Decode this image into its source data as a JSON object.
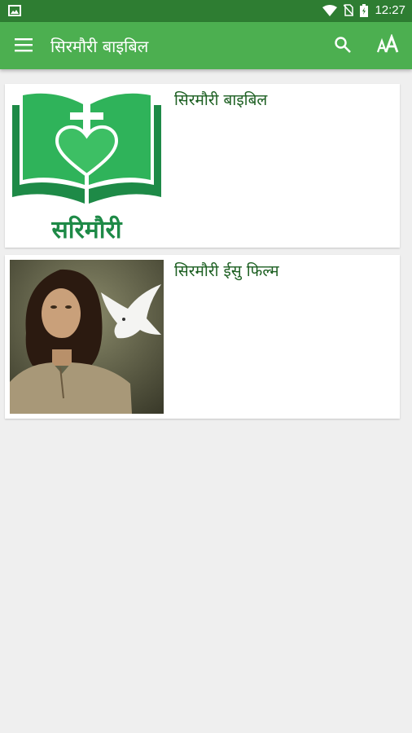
{
  "status_bar": {
    "time": "12:27"
  },
  "app_bar": {
    "title": "सिरमौरी बाइबिल"
  },
  "icons": {
    "menu": "hamburger-menu-icon",
    "search": "search-icon",
    "text_size": "text-size-icon"
  },
  "colors": {
    "status_bar": "#2e7d32",
    "app_bar": "#4caf50",
    "label_text": "#1b5e20",
    "logo_green": "#1e8a47"
  },
  "items": [
    {
      "label": "सिरमौरी बाइबिल",
      "logo_text": "सरिमौरी"
    },
    {
      "label": "सिरमौरी ईसु फिल्म"
    }
  ]
}
